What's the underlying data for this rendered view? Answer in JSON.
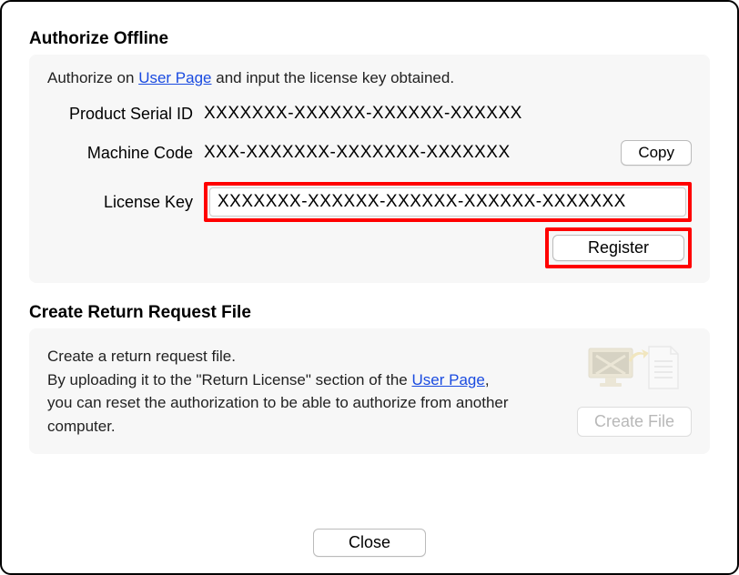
{
  "authorize": {
    "title": "Authorize Offline",
    "instruction_prefix": "Authorize on ",
    "instruction_link": "User Page",
    "instruction_suffix": " and input the license key obtained.",
    "fields": {
      "serial_label": "Product Serial ID",
      "serial_value": "XXXXXXX-XXXXXX-XXXXXX-XXXXXX",
      "machine_label": "Machine Code",
      "machine_value": "XXX-XXXXXXX-XXXXXXX-XXXXXXX",
      "copy_label": "Copy",
      "license_label": "License Key",
      "license_value": "XXXXXXX-XXXXXX-XXXXXX-XXXXXX-XXXXXXX"
    },
    "register_label": "Register"
  },
  "return_request": {
    "title": "Create Return Request File",
    "line1": "Create a return request file.",
    "line2_prefix": "By uploading it to the \"Return License\" section of the ",
    "line2_link": "User Page",
    "line2_suffix": ", you can reset the authorization to be able to authorize from another computer.",
    "create_label": "Create File"
  },
  "footer": {
    "close_label": "Close"
  }
}
